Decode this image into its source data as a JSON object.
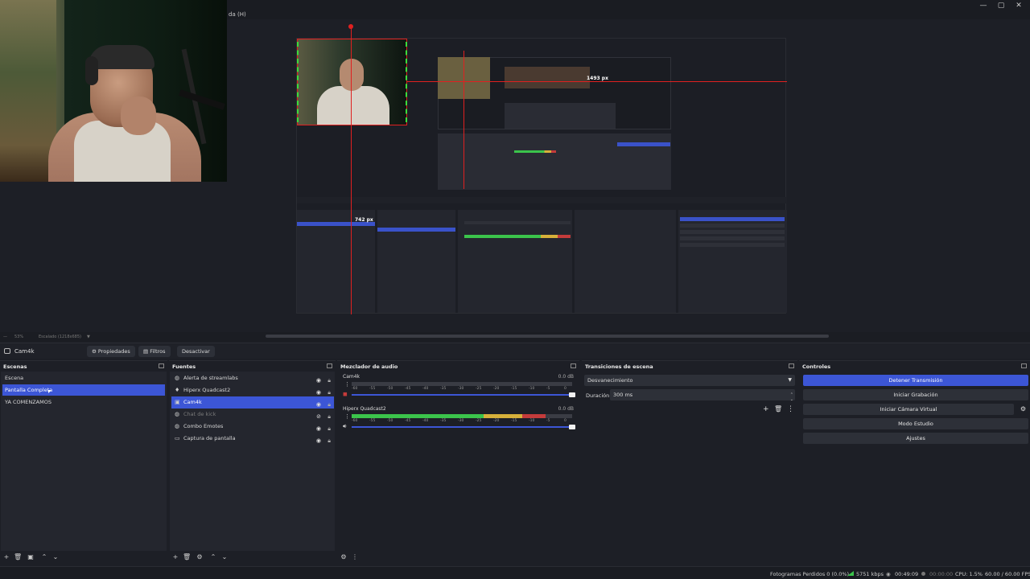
{
  "window": {
    "menu_fragment": "da (H)",
    "minimize": "—",
    "maximize": "▢",
    "close": "✕"
  },
  "preview": {
    "measure_horizontal": "1493 px",
    "measure_vertical": "742 px",
    "zoom": "53%",
    "scaling": "Escalado (1218x685)"
  },
  "source_toolbar": {
    "source_name": "Cam4k",
    "properties": "Propiedades",
    "filters": "Filtros",
    "deactivate": "Desactivar"
  },
  "scenes": {
    "title": "Escenas",
    "items": [
      {
        "label": "Escena",
        "selected": false
      },
      {
        "label": "Pantalla Completa",
        "selected": true
      },
      {
        "label": "YA COMENZAMOS",
        "selected": false
      }
    ]
  },
  "sources": {
    "title": "Fuentes",
    "items": [
      {
        "label": "Alerta de streamlabs",
        "icon": "globe-icon",
        "selected": false,
        "hidden": false
      },
      {
        "label": "Hiperx Quadcast2",
        "icon": "mic-icon",
        "selected": false,
        "hidden": false
      },
      {
        "label": "Cam4k",
        "icon": "camera-icon",
        "selected": true,
        "hidden": false
      },
      {
        "label": "Chat de kick",
        "icon": "globe-icon",
        "selected": false,
        "hidden": true
      },
      {
        "label": "Combo Emotes",
        "icon": "globe-icon",
        "selected": false,
        "hidden": false
      },
      {
        "label": "Captura de pantalla",
        "icon": "monitor-icon",
        "selected": false,
        "hidden": false
      }
    ]
  },
  "mixer": {
    "title": "Mezclador de audio",
    "ticks": [
      "-60",
      "-55",
      "-50",
      "-45",
      "-40",
      "-35",
      "-30",
      "-25",
      "-20",
      "-15",
      "-10",
      "-5",
      "0"
    ],
    "channels": [
      {
        "name": "Cam4k",
        "db": "0.0 dB",
        "level": 0.0,
        "muted": true
      },
      {
        "name": "Hiperx Quadcast2",
        "db": "0.0 dB",
        "level": 0.88,
        "muted": false
      }
    ]
  },
  "transitions": {
    "title": "Transiciones de escena",
    "selected": "Desvanecimiento",
    "duration_label": "Duración",
    "duration_value": "300 ms"
  },
  "controls": {
    "title": "Controles",
    "buttons": [
      {
        "label": "Detener Transmisión",
        "primary": true
      },
      {
        "label": "Iniciar Grabación",
        "primary": false
      },
      {
        "label": "Iniciar Cámara Virtual",
        "primary": false
      },
      {
        "label": "Modo Estudio",
        "primary": false
      },
      {
        "label": "Ajustes",
        "primary": false
      }
    ]
  },
  "status": {
    "dropped_frames": "Fotogramas Perdidos 0 (0.0%)",
    "bitrate": "5751 kbps",
    "stream_time": "00:49:09",
    "rec_time": "00:00:00",
    "cpu": "CPU: 1.5%",
    "fps": "60.00 / 60.00 FPS"
  },
  "colors": {
    "accent": "#3c56d6",
    "guide": "#e02020",
    "meter_green": "#3bc44b",
    "meter_yellow": "#d7b03a",
    "meter_red": "#c43b3b"
  }
}
